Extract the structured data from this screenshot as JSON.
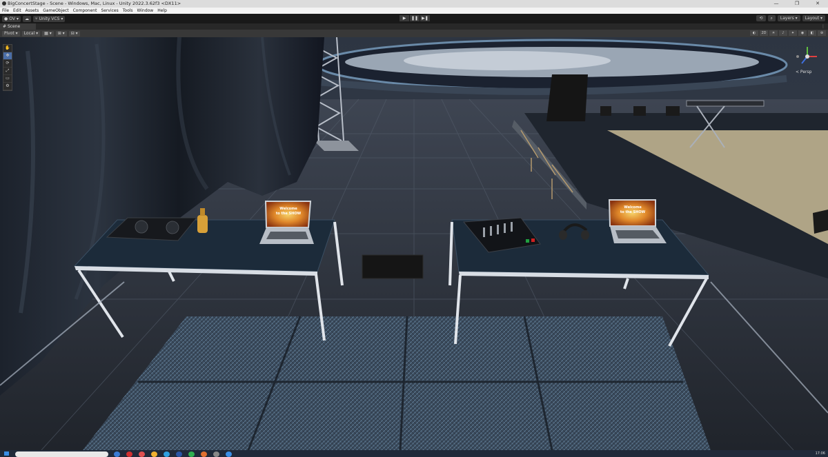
{
  "window": {
    "title": "BigConcertStage - Scene - Windows, Mac, Linux - Unity 2022.3.62f3 <DX11>",
    "controls": [
      "—",
      "❐",
      "✕"
    ]
  },
  "menu": [
    "File",
    "Edit",
    "Assets",
    "GameObject",
    "Component",
    "Services",
    "Tools",
    "Window",
    "Help"
  ],
  "toolbar": {
    "account_label": "OV",
    "cloud_icon": "cloud-icon",
    "vcs_label": "Unity VCS",
    "play_label": "▶",
    "pause_label": "❚❚",
    "step_label": "▶❚",
    "history_icon": "history-icon",
    "search_icon": "search-icon",
    "layers_label": "Layers",
    "layout_label": "Layout"
  },
  "scene_tab": {
    "label": "Scene",
    "menu": "⋮"
  },
  "scene_toolbar": {
    "pivot_label": "Pivot",
    "local_label": "Local",
    "mode_2d": "2D"
  },
  "tools": [
    "✋",
    "✥",
    "⟳",
    "⤢",
    "▭",
    "⚙"
  ],
  "gizmo": {
    "persp_label": "< Persp",
    "y_label": "y",
    "x_label": "x",
    "z_label": "z"
  },
  "laptop_screen": {
    "line1": "Welcome",
    "line2": "to the SHOW"
  },
  "taskbar": {
    "clock": "17:06"
  },
  "colors": {
    "laptop_fire": "#e0882a",
    "stage_floor": "#c9bb95",
    "gizmo_x": "#e04040",
    "gizmo_y": "#60c040",
    "gizmo_z": "#4070e0"
  }
}
